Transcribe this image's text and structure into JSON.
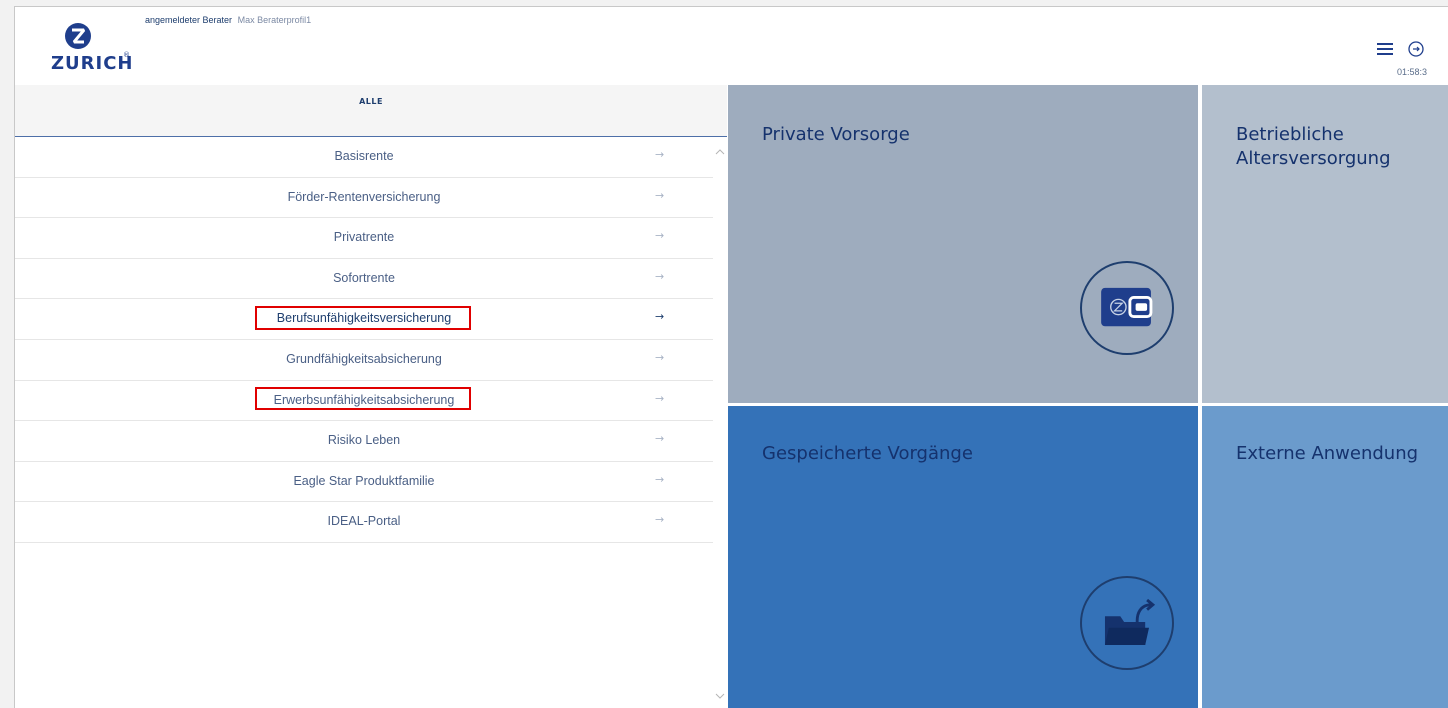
{
  "header": {
    "logo_text": "ZURICH",
    "logo_reg": "®",
    "user_label": "angemeldeter Berater",
    "user_name": "Max Beraterprofil1",
    "timer": "01:58:3"
  },
  "tabs": {
    "alle": "ALLE"
  },
  "list": {
    "items": [
      {
        "label": "Basisrente"
      },
      {
        "label": "Förder-Rentenversicherung"
      },
      {
        "label": "Privatrente"
      },
      {
        "label": "Sofortrente"
      },
      {
        "label": "Berufsunfähigkeitsversicherung"
      },
      {
        "label": "Grundfähigkeitsabsicherung"
      },
      {
        "label": "Erwerbsunfähigkeitsabsicherung"
      },
      {
        "label": "Risiko Leben"
      },
      {
        "label": "Eagle Star Produktfamilie"
      },
      {
        "label": "IDEAL-Portal"
      }
    ],
    "arrow": "→",
    "active_index": 4,
    "highlighted_indices": [
      4,
      6
    ]
  },
  "tiles": {
    "private": "Private Vorsorge",
    "betrieblich_1": "Betriebliche",
    "betrieblich_2": "Altersversorgung",
    "gespeichert": "Gespeicherte Vorgänge",
    "extern": "Externe Anwendung"
  },
  "icons": {
    "menu": "hamburger-icon",
    "logout": "logout-icon",
    "wallet": "wallet-icon",
    "folder": "folder-icon"
  },
  "colors": {
    "brand": "#1f3e8c",
    "highlight": "#e00000",
    "tile_private": "#9eacbe",
    "tile_betrieblich": "#b3bfcd",
    "tile_gespeichert": "#3472b8",
    "tile_extern": "#6b9bcc"
  }
}
